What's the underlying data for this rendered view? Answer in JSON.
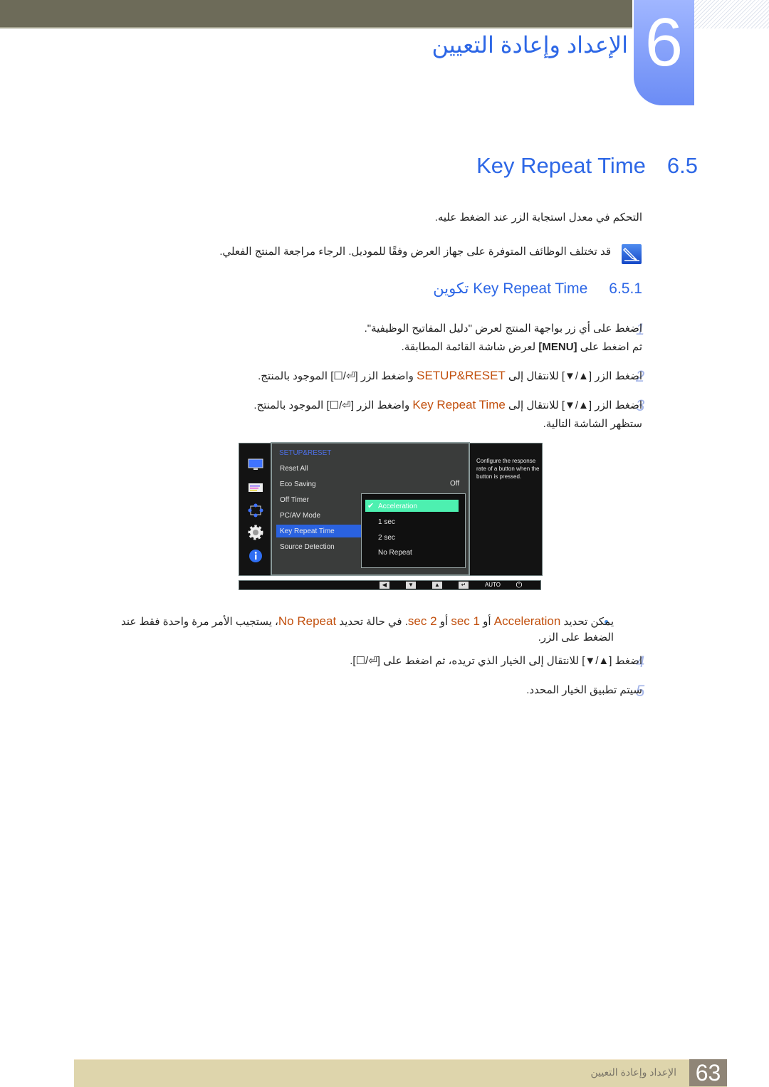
{
  "header": {
    "chapter_number": "6",
    "chapter_title": "الإعداد وإعادة التعيين"
  },
  "section": {
    "number": "6.5",
    "title": "Key Repeat Time",
    "intro": "التحكم في معدل استجابة الزر عند الضغط عليه.",
    "note": "قد تختلف الوظائف المتوفرة على جهاز العرض وفقًا للموديل. الرجاء مراجعة المنتج الفعلي."
  },
  "subsection": {
    "number": "6.5.1",
    "title": "تكوين Key Repeat Time"
  },
  "steps": [
    {
      "num": "1",
      "line1": "اضغط على أي زر بواجهة المنتج لعرض \"دليل المفاتيح الوظيفية\".",
      "line2_pre": "ثم اضغط على ",
      "line2_key": "[MENU]",
      "line2_post": " لعرض شاشة القائمة المطابقة."
    },
    {
      "num": "2",
      "pre": "اضغط الزر [▲/▼] للانتقال إلى ",
      "hl": "SETUP&RESET",
      "post": " واضغط الزر [⏎/☐] الموجود بالمنتج."
    },
    {
      "num": "3",
      "pre": "اضغط الزر [▲/▼] للانتقال إلى ",
      "hl": "Key Repeat Time",
      "post": " واضغط الزر [⏎/☐] الموجود بالمنتج.",
      "line2": "ستظهر الشاشة التالية."
    },
    {
      "num": "4",
      "text": "اضغط [▲/▼] للانتقال إلى الخيار الذي تريده، ثم اضغط على [⏎/☐]."
    },
    {
      "num": "5",
      "text": "سيتم تطبيق الخيار المحدد."
    }
  ],
  "bullet": {
    "p1": "يمكن تحديد ",
    "h1": "Acceleration",
    "p2": " أو ",
    "h2": "1 sec",
    "p3": " أو ",
    "h3": "2 sec",
    "p4": ". في حالة تحديد ",
    "h4": "No Repeat",
    "p5": "، يستجيب الأمر مرة واحدة فقط عند الضغط على الزر."
  },
  "osd": {
    "menu_title": "SETUP&RESET",
    "items": [
      "Reset All",
      "Eco Saving",
      "Off Timer",
      "PC/AV Mode",
      "Key Repeat Time",
      "Source Detection"
    ],
    "selected_item": "Key Repeat Time",
    "eco_saving_value": "Off",
    "submenu": [
      "Acceleration",
      "1 sec",
      "2 sec",
      "No Repeat"
    ],
    "submenu_selected": "Acceleration",
    "help_text": "Configure the response rate of a button when the button is pressed.",
    "side_icons": [
      "monitor-icon",
      "color-icon",
      "size-position-icon",
      "setup-gear-icon",
      "info-icon"
    ],
    "keys": [
      "◀",
      "▼",
      "▲",
      "↵",
      "AUTO",
      "⏻"
    ]
  },
  "footer": {
    "page_number": "63",
    "chapter_title": "الإعداد وإعادة التعيين"
  }
}
